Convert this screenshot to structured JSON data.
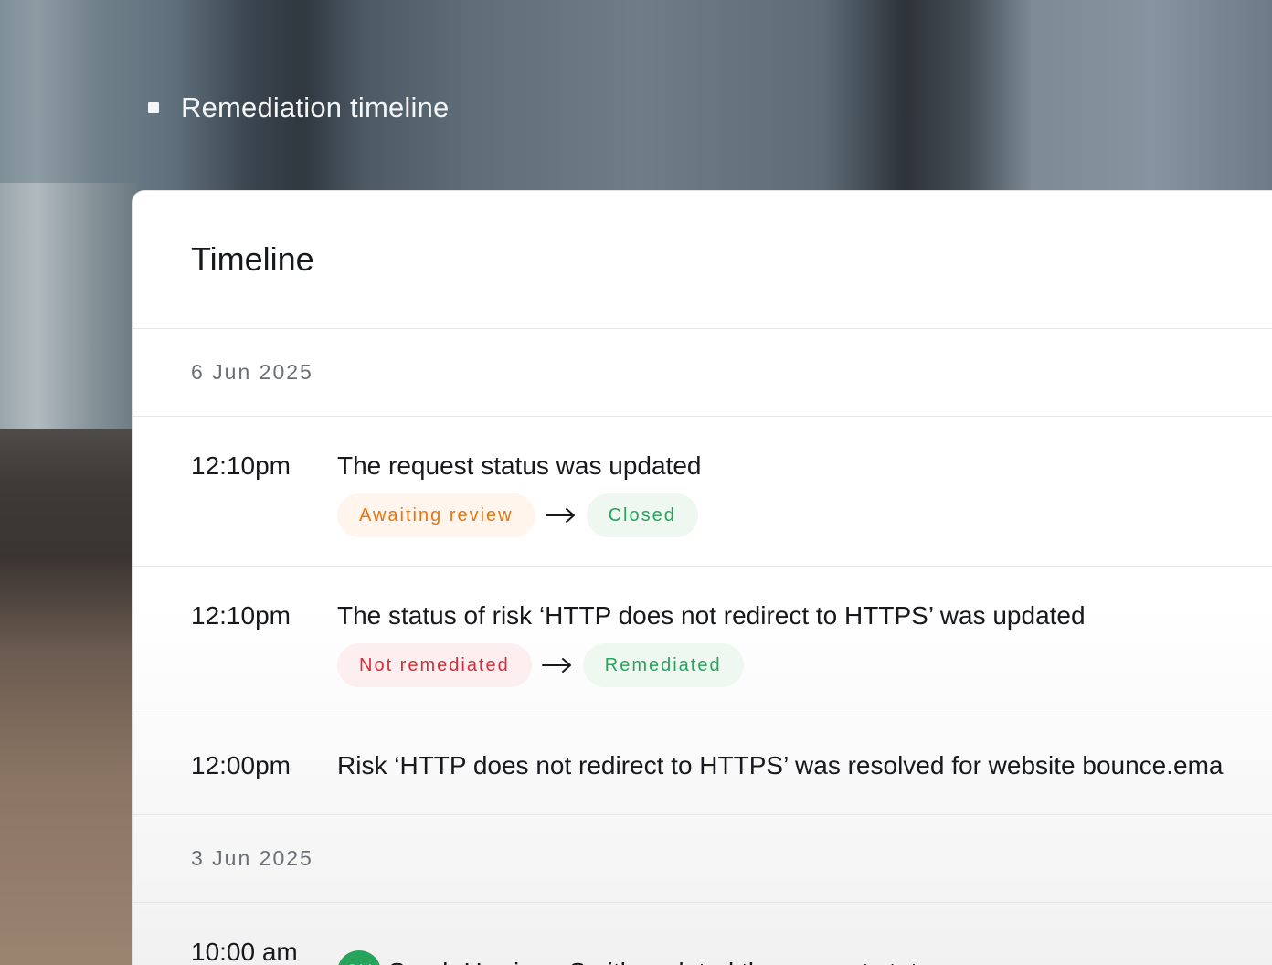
{
  "section": {
    "label": "Remediation timeline"
  },
  "card": {
    "title": "Timeline"
  },
  "groups": [
    {
      "date": "6 Jun 2025"
    },
    {
      "date": "3 Jun 2025"
    }
  ],
  "events": [
    {
      "time": "12:10pm",
      "text": "The request status was updated",
      "from": "Awaiting review",
      "to": "Closed"
    },
    {
      "time": "12:10pm",
      "text": "The status of risk ‘HTTP does not redirect to HTTPS’ was updated",
      "from": "Not remediated",
      "to": "Remediated"
    },
    {
      "time": "12:00pm",
      "text": "Risk ‘HTTP does not redirect to HTTPS’ was resolved for website bounce.ema"
    },
    {
      "time": "10:00 am",
      "avatar_initials": "SH",
      "text": "Sarah Harrison-Smith updated the request status"
    }
  ],
  "colors": {
    "awaiting_review": "#e47612",
    "closed": "#27a35c",
    "not_remediated": "#d92c3a",
    "remediated": "#27a35c",
    "avatar_bg": "#27a35c"
  },
  "icons": {
    "transition": "arrow-right-icon"
  }
}
